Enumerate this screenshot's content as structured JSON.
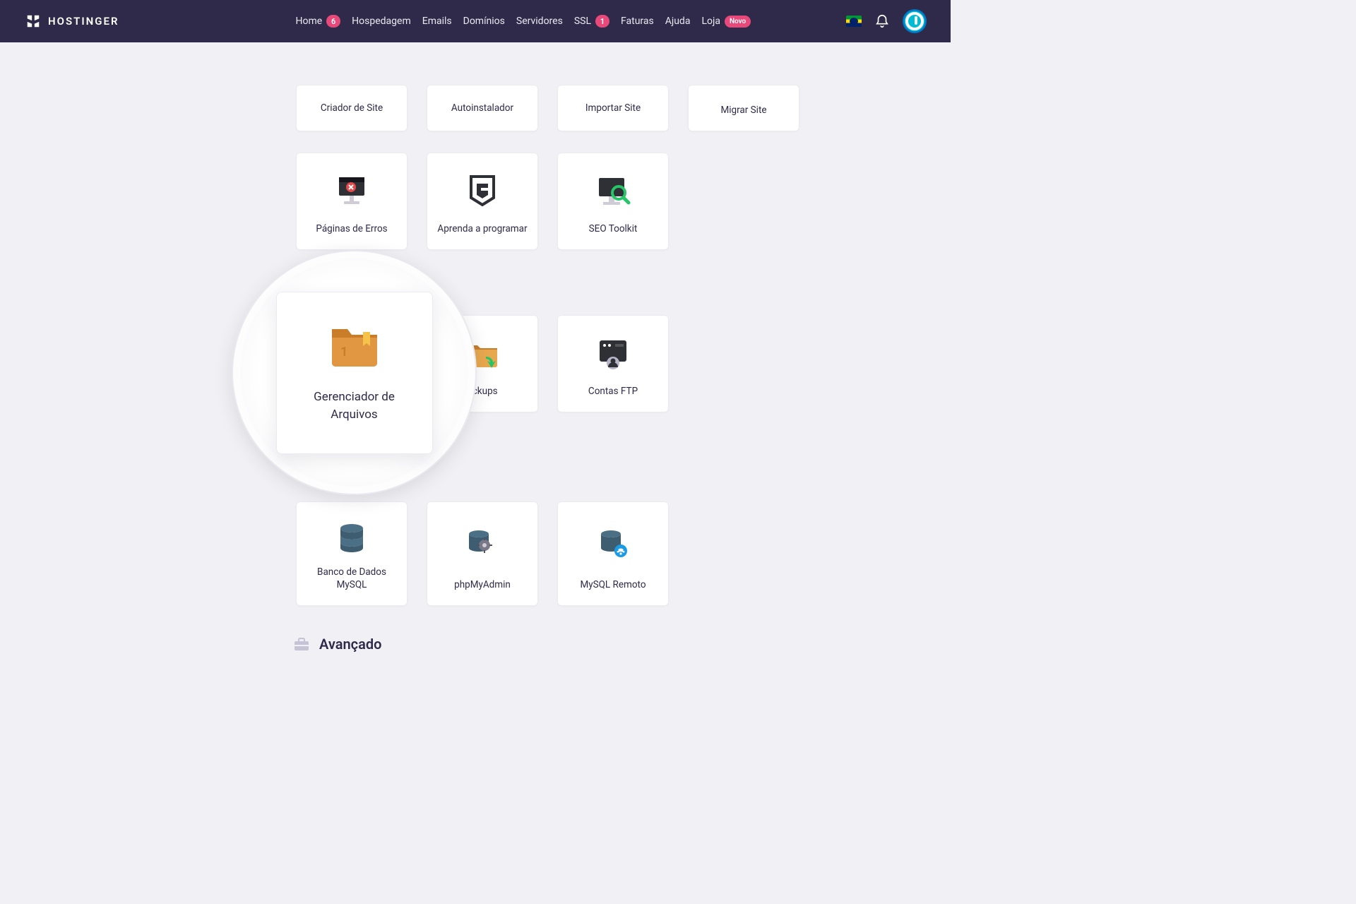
{
  "brand": "HOSTINGER",
  "nav": {
    "home": "Home",
    "home_badge": "6",
    "hospedagem": "Hospedagem",
    "emails": "Emails",
    "dominios": "Domínios",
    "servidores": "Servidores",
    "ssl": "SSL",
    "ssl_badge": "1",
    "faturas": "Faturas",
    "ajuda": "Ajuda",
    "loja": "Loja",
    "loja_badge": "Novo"
  },
  "cards": {
    "row1": {
      "criador": "Criador de Site",
      "autoinstalador": "Autoinstalador",
      "importar": "Importar Site",
      "migrar": "Migrar Site"
    },
    "row2": {
      "erros": "Páginas de Erros",
      "aprenda": "Aprenda a programar",
      "seo": "SEO Toolkit"
    },
    "row3": {
      "gerenciador": "Gerenciador de Arquivos",
      "backups": "ackups",
      "ftp": "Contas FTP"
    },
    "row4": {
      "mysql": "Banco de Dados MySQL",
      "phpmyadmin": "phpMyAdmin",
      "mysqlremoto": "MySQL Remoto"
    }
  },
  "lens_card": "Gerenciador de\nArquivos",
  "section_advanced": "Avançado"
}
